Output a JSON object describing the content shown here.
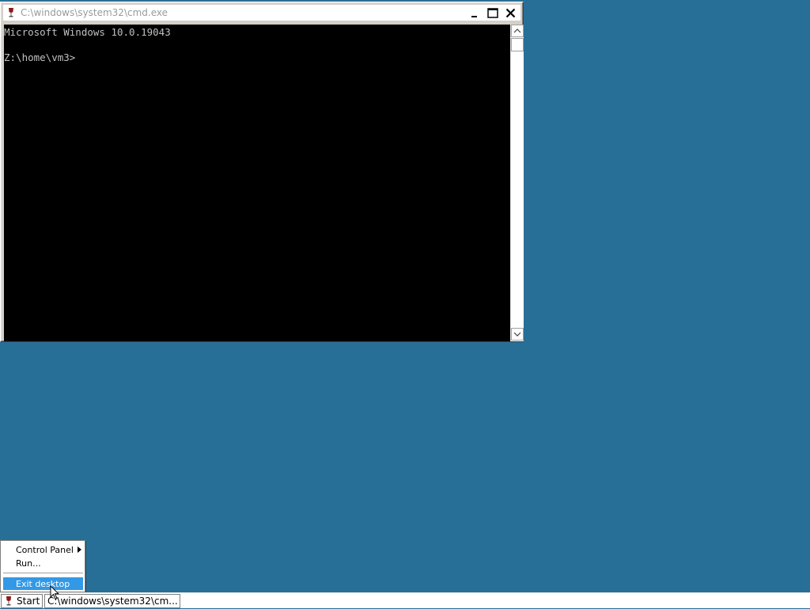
{
  "desktop": {
    "background_color": "#286f97"
  },
  "window": {
    "title": "C:\\windows\\system32\\cmd.exe",
    "icon": "wine-glass-icon",
    "buttons": [
      "minimize-icon",
      "maximize-icon",
      "close-icon"
    ],
    "console_lines": [
      "Microsoft Windows 10.0.19043",
      "",
      "Z:\\home\\vm3>"
    ]
  },
  "start_menu": {
    "items": [
      {
        "label": "Control Panel",
        "has_submenu": true
      },
      {
        "label": "Run..."
      },
      {
        "label": "Exit desktop",
        "highlighted": true
      }
    ]
  },
  "taskbar": {
    "start_label": "Start",
    "start_icon": "wine-glass-icon",
    "tasks": [
      {
        "label": "C:\\windows\\system32\\cm..."
      }
    ]
  },
  "colors": {
    "highlight": "#3399e6",
    "console_bg": "#000000",
    "console_text": "#c0c0c0"
  }
}
